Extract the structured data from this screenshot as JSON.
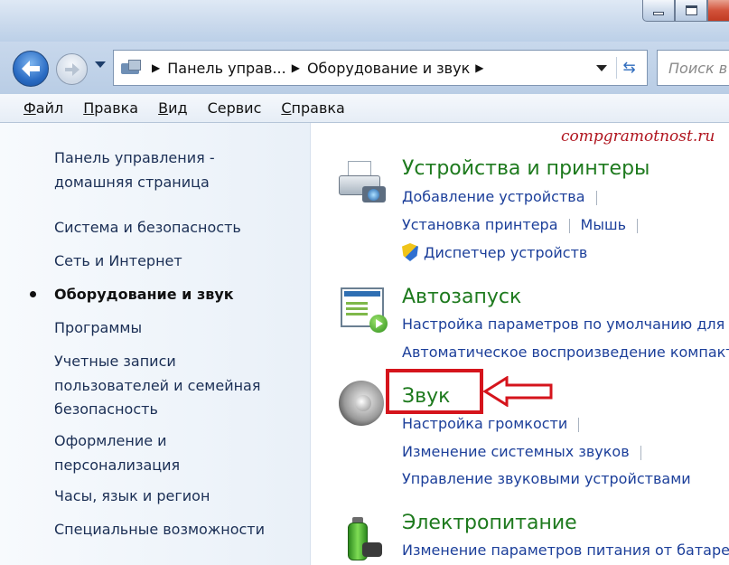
{
  "window": {
    "min_label": "",
    "max_label": ""
  },
  "address": {
    "crumbs": [
      "Панель управ...",
      "Оборудование и звук"
    ],
    "search_placeholder": "Поиск в"
  },
  "menubar": [
    {
      "accel": "Ф",
      "rest": "айл"
    },
    {
      "accel": "П",
      "rest": "равка"
    },
    {
      "accel": "В",
      "rest": "ид"
    },
    {
      "accel": "",
      "rest": "Сервис"
    },
    {
      "accel": "С",
      "rest": "правка"
    }
  ],
  "sidebar": {
    "home": "Панель управления -\nдомашняя страница",
    "items": [
      "Система и безопасность",
      "Сеть и Интернет",
      "Оборудование и звук",
      "Программы",
      "Учетные записи\nпользователей и семейная\nбезопасность",
      "Оформление и\nперсонализация",
      "Часы, язык и регион",
      "Специальные возможности"
    ]
  },
  "watermark": "compgramotnost.ru",
  "categories": {
    "devices": {
      "title": "Устройства и принтеры",
      "tasks": [
        "Добавление устройства",
        "Установка принтера",
        "Мышь",
        "Диспетчер устройств"
      ]
    },
    "autoplay": {
      "title": "Автозапуск",
      "tasks": [
        "Настройка параметров по умолчанию для носителей или устройств",
        "Автоматическое воспроизведение компакт-дисков или других носителей"
      ]
    },
    "sound": {
      "title": "Звук",
      "tasks": [
        "Настройка громкости",
        "Изменение системных звуков",
        "Управление звуковыми устройствами"
      ]
    },
    "power": {
      "title": "Электропитание",
      "tasks": [
        "Изменение параметров питания от батареи"
      ]
    }
  },
  "colors": {
    "highlight": "#d5141c",
    "category_title": "#1e7a1e",
    "link": "#1c3f9a"
  }
}
